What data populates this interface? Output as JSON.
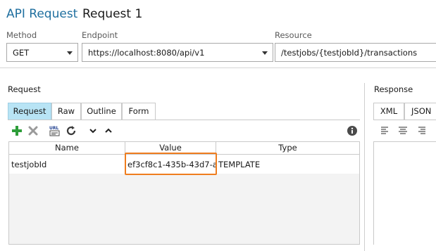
{
  "header": {
    "app_label": "API Request",
    "request_name": "Request 1"
  },
  "fields": {
    "method": {
      "label": "Method",
      "value": "GET"
    },
    "endpoint": {
      "label": "Endpoint",
      "value": "https://localhost:8080/api/v1"
    },
    "resource": {
      "label": "Resource",
      "value": "/testjobs/{testjobId}/transactions"
    }
  },
  "request_panel": {
    "title": "Request",
    "tabs": [
      {
        "label": "Request",
        "active": true
      },
      {
        "label": "Raw",
        "active": false
      },
      {
        "label": "Outline",
        "active": false
      },
      {
        "label": "Form",
        "active": false
      }
    ],
    "toolbar": {
      "add_icon": "plus-icon",
      "delete_icon": "delete-x-icon",
      "url_icon": "url-encode-icon",
      "refresh_icon": "refresh-icon",
      "move_down_icon": "chevron-down-icon",
      "move_up_icon": "chevron-up-icon",
      "info_icon": "info-icon"
    },
    "table": {
      "columns": [
        "Name",
        "Value",
        "Type"
      ],
      "rows": [
        {
          "name": "testjobId",
          "value": "ef3cf8c1-435b-43d7-a...",
          "type": "TEMPLATE"
        }
      ]
    }
  },
  "response_panel": {
    "title": "Response",
    "tabs": [
      {
        "label": "XML",
        "active": true
      },
      {
        "label": "JSON",
        "active": false
      }
    ]
  },
  "colors": {
    "brand": "#1f6f9f",
    "active_tab": "#b8e4f5",
    "highlight": "#ef7d1e",
    "add_green": "#2e9d3a"
  }
}
